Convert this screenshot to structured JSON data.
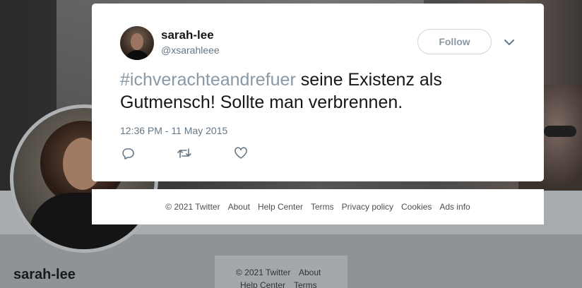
{
  "background_profile": {
    "name": "sarah-lee",
    "footer": {
      "line1": [
        "© 2021 Twitter",
        "About"
      ],
      "line2": [
        "Help Center",
        "Terms"
      ]
    }
  },
  "tweet": {
    "author_name": "sarah-lee",
    "author_handle": "@xsarahleee",
    "follow_label": "Follow",
    "hashtag": "#ichverachteandrefuer",
    "text": " seine Existenz als Gutmensch! Sollte man verbrennen.",
    "timestamp": "12:36 PM - 11 May 2015",
    "actions": [
      "reply-icon",
      "retweet-icon",
      "like-icon"
    ]
  },
  "footer": {
    "links": [
      "© 2021 Twitter",
      "About",
      "Help Center",
      "Terms",
      "Privacy policy",
      "Cookies",
      "Ads info"
    ]
  },
  "colors": {
    "hashtag": "#8899a6",
    "text": "#14171a",
    "secondary": "#657786"
  }
}
